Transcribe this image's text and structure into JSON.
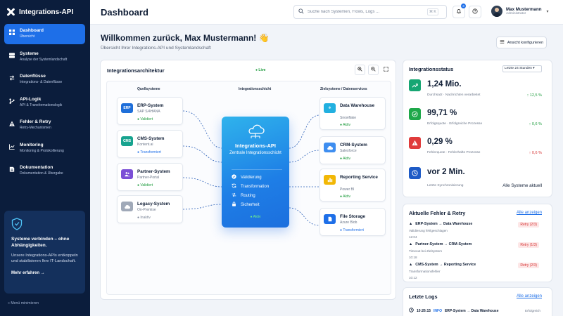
{
  "app": {
    "name": "Integrations-API"
  },
  "sidebar": {
    "items": [
      {
        "title": "Dashboard",
        "sub": "Übersicht",
        "icon": "dashboard-icon"
      },
      {
        "title": "Systeme",
        "sub": "Analyse der Systemlandschaft",
        "icon": "server-icon"
      },
      {
        "title": "Datenflüsse",
        "sub": "Integrations- & Datenflüsse",
        "icon": "flow-icon"
      },
      {
        "title": "API-Logik",
        "sub": "API & Transformationslogik",
        "icon": "branch-icon"
      },
      {
        "title": "Fehler & Retry",
        "sub": "Retry-Mechanismen",
        "icon": "error-icon"
      },
      {
        "title": "Monitoring",
        "sub": "Monitoring & Protokollierung",
        "icon": "chart-icon"
      },
      {
        "title": "Dokumentation",
        "sub": "Dokumentation & Übergabe",
        "icon": "book-icon"
      }
    ],
    "promo": {
      "title": "Systeme verbinden – ohne Abhängigkeiten.",
      "text": "Unsere Integrations-APIs entkoppeln und stabilisieren Ihre IT-Landschaft.",
      "link": "Mehr erfahren →"
    },
    "collapse": "« Menü minimieren"
  },
  "header": {
    "title": "Dashboard",
    "search_placeholder": "Suche nach Systemen, Flows, Logs ...",
    "shortcut": "⌘ K",
    "notifications": "3",
    "user": {
      "name": "Max Mustermann",
      "role": "Administrator"
    }
  },
  "welcome": {
    "title": "Willkommen zurück, Max Mustermann! 👋",
    "subtitle": "Übersicht Ihrer Integrations-API und Systemlandschaft",
    "config": "Ansicht konfigurieren"
  },
  "architecture": {
    "title": "Integrationsarchitektur",
    "live": "● Live",
    "col_sources": "Quellsysteme",
    "col_hub": "Integrationsschicht",
    "col_targets": "Zielsysteme / Datenservices",
    "sources": [
      {
        "name": "ERP-System",
        "sub": "SAP S/4HANA",
        "status": "● Validiert",
        "tone": "green",
        "logo": "ERP",
        "color": "#1f6fd9"
      },
      {
        "name": "CMS-System",
        "sub": "Kontent.ai",
        "status": "● Transformiert",
        "tone": "blue",
        "logo": "CMS",
        "color": "#17a38f"
      },
      {
        "name": "Partner-System",
        "sub": "Partner-Portal",
        "status": "● Validiert",
        "tone": "green",
        "logo": "",
        "color": "#7b4fd6"
      },
      {
        "name": "Legacy-System",
        "sub": "On-Premise",
        "status": "● Inaktiv",
        "tone": "gray",
        "logo": "",
        "color": "#a0a9b8"
      }
    ],
    "targets": [
      {
        "name": "Data Warehouse",
        "sub": "Snowflake",
        "status": "● Aktiv",
        "tone": "green",
        "logo": "",
        "color": "#22b0e0"
      },
      {
        "name": "CRM-System",
        "sub": "Salesforce",
        "status": "● Aktiv",
        "tone": "green",
        "logo": "",
        "color": "#3e8ef0"
      },
      {
        "name": "Reporting Service",
        "sub": "Power BI",
        "status": "● Aktiv",
        "tone": "green",
        "logo": "",
        "color": "#f2b705"
      },
      {
        "name": "File Storage",
        "sub": "Azure Blob",
        "status": "● Transformiert",
        "tone": "blue",
        "logo": "",
        "color": "#1e6fe8"
      }
    ],
    "hub": {
      "title": "Integrations-API",
      "subtitle": "Zentrale Integrationsschicht",
      "items": [
        "Validierung",
        "Transformation",
        "Routing",
        "Sicherheit"
      ],
      "footer": "● Aktiv"
    }
  },
  "status": {
    "title": "Integrationsstatus",
    "range": "Letzte 24 Stunden",
    "kpis": [
      {
        "value": "1,24 Mio.",
        "desc": "Durchsatz · Nachrichten verarbeitet",
        "delta": "↑ 12,5 %",
        "tone": "green",
        "color": "#17a673",
        "icon": "trend-icon"
      },
      {
        "value": "99,71 %",
        "desc": "Erfolgsquote · Erfolgreiche Prozesse",
        "delta": "↑ 0,6 %",
        "tone": "green",
        "color": "#1ea84a",
        "icon": "check-icon"
      },
      {
        "value": "0,29 %",
        "desc": "Fehlerquote · Fehlerhafte Prozesse",
        "delta": "↑ 0,6 %",
        "tone": "red",
        "color": "#e03b3b",
        "icon": "warning-icon"
      },
      {
        "value": "vor 2 Min.",
        "desc": "Letzte Synchronisierung",
        "delta": "Alle Systeme aktuell",
        "tone": "dark",
        "color": "#1e5bc6",
        "icon": "clock-icon"
      }
    ]
  },
  "errors": {
    "title": "Aktuelle Fehler & Retry",
    "link": "Alle anzeigen",
    "items": [
      {
        "title": "ERP-System → Data Warehouse",
        "desc": "Validierung fehlgeschlagen",
        "time": "12:04",
        "retry": "Retry (2/3)"
      },
      {
        "title": "Partner-System → CRM-System",
        "desc": "Timeout bei Zielsystem",
        "time": "10:18",
        "retry": "Retry (1/3)"
      },
      {
        "title": "CMS-System → Reporting Service",
        "desc": "Transformationsfehler",
        "time": "10:12",
        "retry": "Retry (2/3)"
      }
    ]
  },
  "logs": {
    "title": "Letzte Logs",
    "link": "Alle anzeigen",
    "row": {
      "time": "10:26:15",
      "level": "INFO",
      "text": "ERP-System → Data Warehouse",
      "state": "Erfolgreich"
    }
  }
}
